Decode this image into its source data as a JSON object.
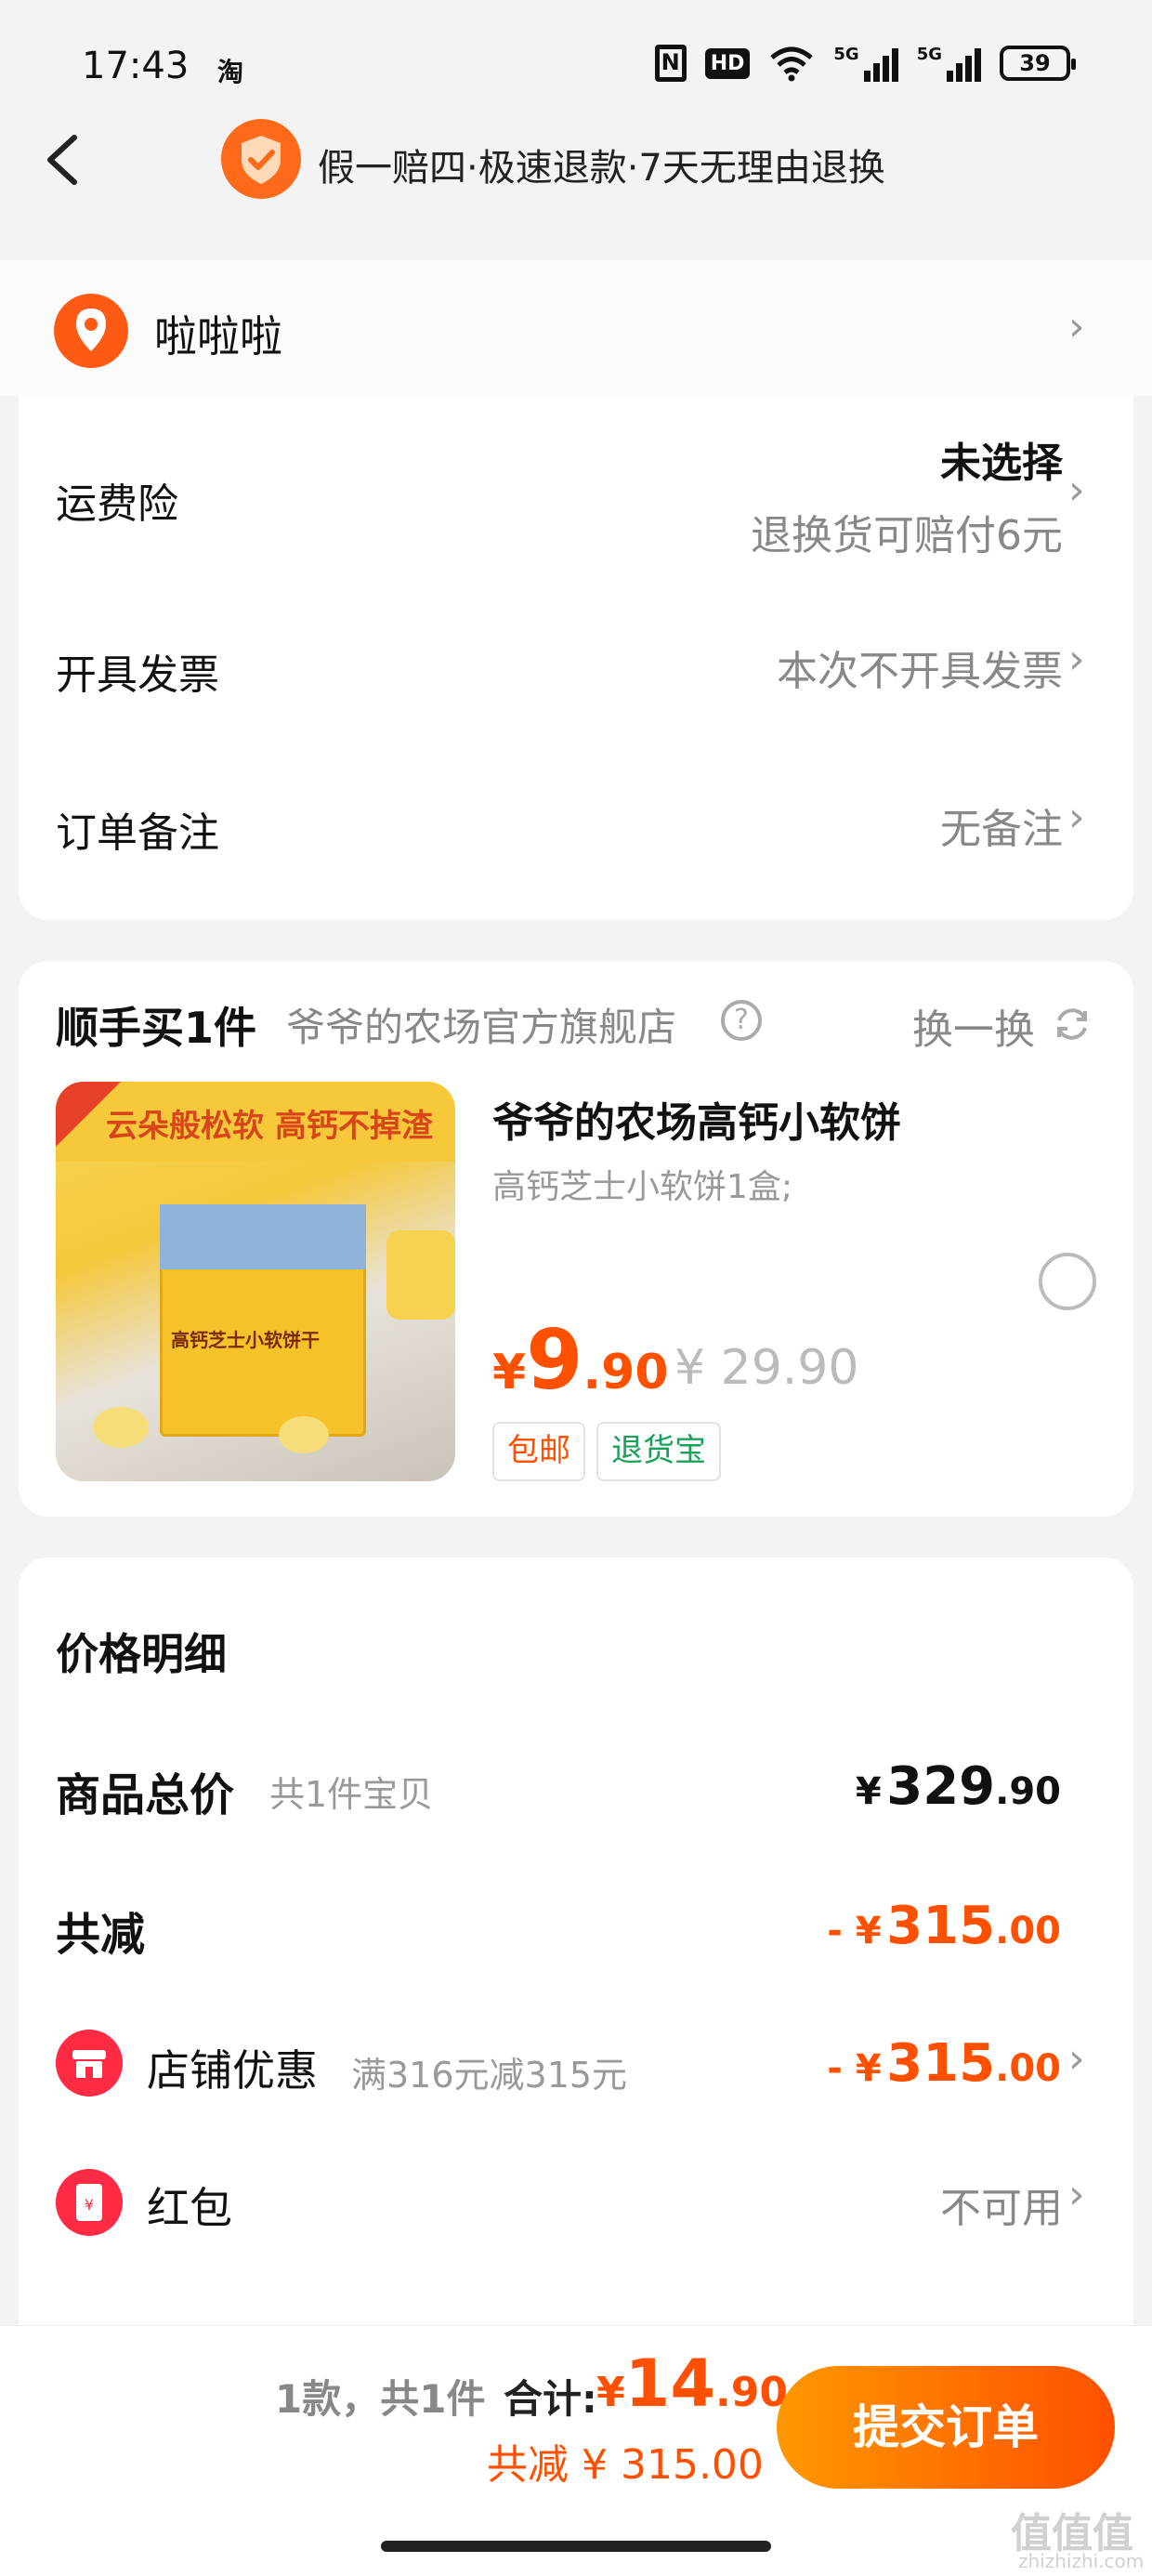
{
  "status_bar": {
    "time": "17:43",
    "app_glyph": "淘",
    "nfc": "N",
    "hd": "HD",
    "signal1_label": "5G",
    "signal2_label": "5G",
    "battery": "39"
  },
  "header": {
    "guarantee_text": "假一赔四·极速退款·7天无理由退换",
    "icons": [
      "back-arrow-icon",
      "shield-check-icon"
    ]
  },
  "address": {
    "name": "啦啦啦"
  },
  "options": {
    "freight_insurance": {
      "label": "运费险",
      "value": "未选择",
      "subvalue": "退换货可赔付6元"
    },
    "invoice": {
      "label": "开具发票",
      "value": "本次不开具发票"
    },
    "note": {
      "label": "订单备注",
      "value": "无备注"
    }
  },
  "buy_more": {
    "title": "顺手买1件",
    "store": "爷爷的农场官方旗舰店",
    "help_icon": "?",
    "swap_label": "换一换",
    "product": {
      "name": "爷爷的农场高钙小软饼",
      "spec": "高钙芝士小软饼1盒;",
      "price_symbol": "¥",
      "price_int": "9",
      "price_dec": ".90",
      "original_price": "¥ 29.90",
      "tags": [
        "包邮",
        "退货宝"
      ],
      "image_banner": "云朵般松软 高钙不掉渣",
      "image_box_title": "高钙芝士小软饼干",
      "selected": false
    }
  },
  "price_detail": {
    "title": "价格明细",
    "goods_total": {
      "label": "商品总价",
      "note": "共1件宝贝",
      "cur": "¥",
      "int": "329",
      "dec": ".90"
    },
    "total_discount": {
      "label": "共减",
      "cur": "- ¥",
      "int": "315",
      "dec": ".00"
    },
    "store_discount": {
      "label": "店铺优惠",
      "note": "满316元减315元",
      "cur": "- ¥",
      "int": "315",
      "dec": ".00"
    },
    "red_packet": {
      "label": "红包",
      "value": "不可用"
    }
  },
  "bottom_bar": {
    "count": "1款，共1件",
    "total_label": "合计:",
    "total_cur": "¥",
    "total_int": "14",
    "total_dec": ".90",
    "saved": "共减 ¥ 315.00",
    "submit_label": "提交订单"
  },
  "watermark": {
    "glyphs": "值值值",
    "domain": "zhizhizhi.com"
  },
  "colors": {
    "accent": "#ff5000",
    "green": "#1aa05a",
    "submit_start": "#ff9800",
    "submit_end": "#ff5000"
  }
}
